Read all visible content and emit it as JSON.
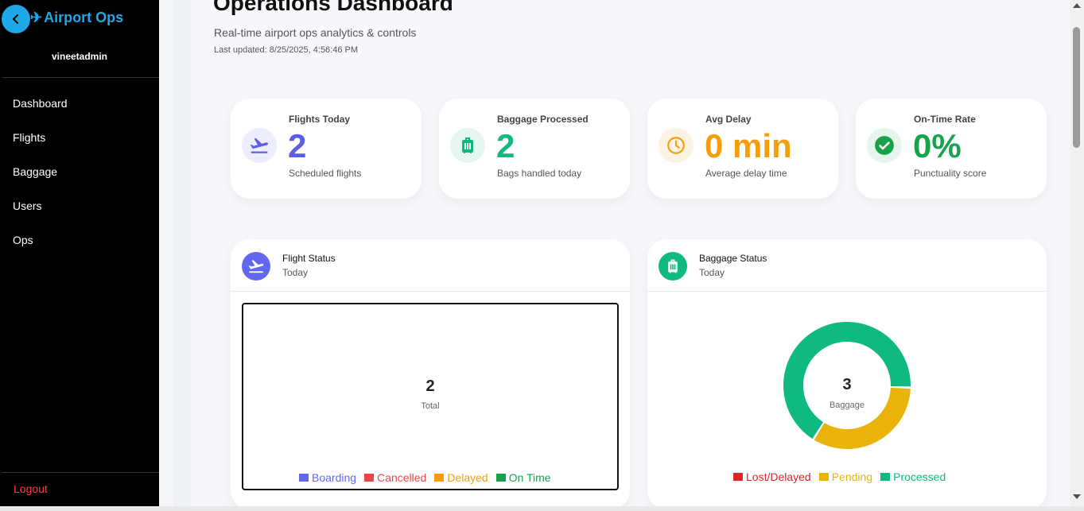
{
  "sidebar": {
    "brand": "Airport Ops",
    "username": "vineetadmin",
    "items": [
      {
        "label": "Dashboard"
      },
      {
        "label": "Flights"
      },
      {
        "label": "Baggage"
      },
      {
        "label": "Users"
      },
      {
        "label": "Ops"
      }
    ],
    "logout": "Logout"
  },
  "header": {
    "title": "Operations Dashboard",
    "subtitle": "Real-time airport ops analytics & controls",
    "last_updated": "Last updated: 8/25/2025, 4:56:46 PM"
  },
  "stats": [
    {
      "label": "Flights Today",
      "value": "2",
      "note": "Scheduled flights",
      "icon": "plane-takeoff-icon",
      "color": "#5b5ee6",
      "bg": "#eceefe"
    },
    {
      "label": "Baggage Processed",
      "value": "2",
      "note": "Bags handled today",
      "icon": "luggage-icon",
      "color": "#10b981",
      "bg": "#e6f7f0"
    },
    {
      "label": "Avg Delay",
      "value": "0 min",
      "note": "Average delay time",
      "icon": "clock-icon",
      "color": "#f59e0b",
      "bg": "#fef3e2"
    },
    {
      "label": "On-Time Rate",
      "value": "0%",
      "note": "Punctuality score",
      "icon": "check-circle-icon",
      "color": "#16a34a",
      "bg": "#e7f6ec"
    }
  ],
  "flight_status": {
    "title": "Flight Status",
    "subtitle": "Today",
    "total": "2",
    "total_label": "Total",
    "legend": [
      {
        "label": "Boarding",
        "color": "#6366f1"
      },
      {
        "label": "Cancelled",
        "color": "#ef4444"
      },
      {
        "label": "Delayed",
        "color": "#f59e0b"
      },
      {
        "label": "On Time",
        "color": "#16a34a"
      }
    ]
  },
  "baggage_status": {
    "title": "Baggage Status",
    "subtitle": "Today",
    "total": "3",
    "total_label": "Baggage",
    "legend": [
      {
        "label": "Lost/Delayed",
        "color": "#dc2626"
      },
      {
        "label": "Pending",
        "color": "#eab308"
      },
      {
        "label": "Processed",
        "color": "#10b981"
      }
    ]
  },
  "chart_data": {
    "type": "pie",
    "categories": [
      "Lost/Delayed",
      "Pending",
      "Processed"
    ],
    "values": [
      0,
      1,
      2
    ],
    "colors": [
      "#dc2626",
      "#eab308",
      "#10b981"
    ],
    "center_text": "3",
    "center_label": "Baggage"
  }
}
